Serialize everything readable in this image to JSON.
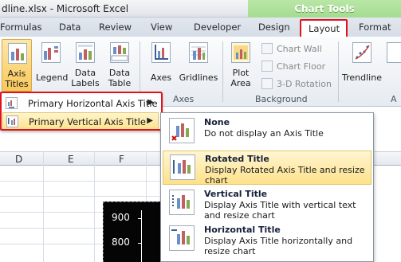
{
  "window": {
    "title": "dline.xlsx - Microsoft Excel"
  },
  "contextual_tab_group": "Chart Tools",
  "tabs": [
    "Formulas",
    "Data",
    "Review",
    "View",
    "Developer",
    "Design",
    "Layout",
    "Format"
  ],
  "ribbon": {
    "axis_titles": {
      "line1": "Axis",
      "line2": "Titles"
    },
    "legend": "Legend",
    "data_labels": {
      "line1": "Data",
      "line2": "Labels"
    },
    "data_table": {
      "line1": "Data",
      "line2": "Table"
    },
    "axes": "Axes",
    "gridlines": "Gridlines",
    "plot_area": {
      "line1": "Plot",
      "line2": "Area"
    },
    "chart_wall": "Chart Wall",
    "chart_floor": "Chart Floor",
    "rotation": "3-D Rotation",
    "trendline": "Trendline",
    "group_axes": "Axes",
    "group_background": "Background",
    "group_partial": "A"
  },
  "columns": [
    "D",
    "E",
    "F"
  ],
  "chart": {
    "ticks": [
      "900",
      "800"
    ]
  },
  "axis_titles_menu": {
    "items": [
      {
        "label": "Primary Horizontal Axis Title",
        "icon": "horizontal-axis-title-icon"
      },
      {
        "label": "Primary Vertical Axis Title",
        "icon": "vertical-axis-title-icon"
      }
    ]
  },
  "vertical_title_submenu": {
    "items": [
      {
        "title": "None",
        "description": "Do not display an Axis Title"
      },
      {
        "title": "Rotated Title",
        "description": "Display Rotated Axis Title and resize chart"
      },
      {
        "title": "Vertical Title",
        "description": "Display Axis Title with vertical text and resize chart"
      },
      {
        "title": "Horizontal Title",
        "description": "Display Axis Title horizontally and resize chart"
      }
    ]
  },
  "colors": {
    "highlight": "#fde48f",
    "callout": "#e0121c",
    "chart_tools": "#8fd07b"
  }
}
